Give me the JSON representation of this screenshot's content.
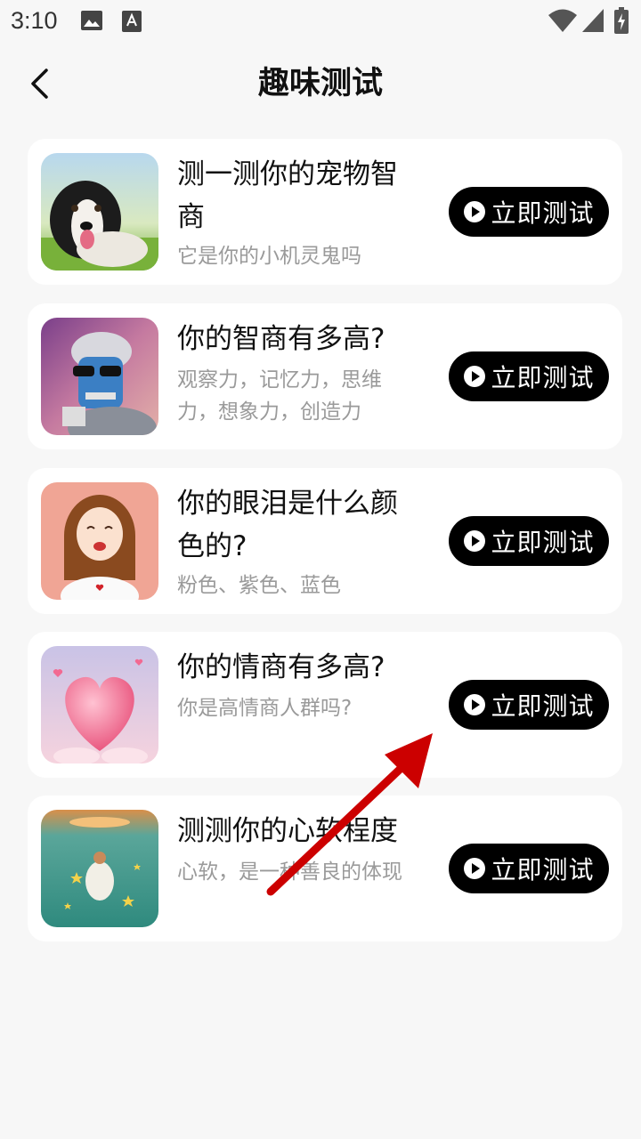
{
  "status_bar": {
    "time": "3:10",
    "icons": [
      "gallery-icon",
      "font-a-icon",
      "wifi-icon",
      "signal-icon",
      "battery-charging-icon"
    ]
  },
  "header": {
    "title": "趣味测试",
    "back_icon": "back-arrow-icon"
  },
  "tests": [
    {
      "title": "测一测你的宠物智商",
      "subtitle": "它是你的小机灵鬼吗",
      "button": "立即测试",
      "image": "dog-photo"
    },
    {
      "title": "你的智商有多高?",
      "subtitle": "观察力，记忆力，思维力，想象力，创造力",
      "button": "立即测试",
      "image": "cyber-face-art"
    },
    {
      "title": "你的眼泪是什么颜色的?",
      "subtitle": "粉色、紫色、蓝色",
      "button": "立即测试",
      "image": "crying-girl-illustration"
    },
    {
      "title": "你的情商有多高?",
      "subtitle": "你是高情商人群吗?",
      "button": "立即测试",
      "image": "pink-heart-art"
    },
    {
      "title": "测测你的心软程度",
      "subtitle": "心软，是一种善良的体现",
      "button": "立即测试",
      "image": "lake-girl-illustration"
    }
  ],
  "colors": {
    "background": "#f7f7f7",
    "card": "#ffffff",
    "button_bg": "#000000",
    "button_text": "#ffffff",
    "subtitle": "#9a9a9a",
    "annotation_arrow": "#cc0000"
  },
  "annotation": {
    "type": "arrow",
    "points_to": "立即测试"
  }
}
